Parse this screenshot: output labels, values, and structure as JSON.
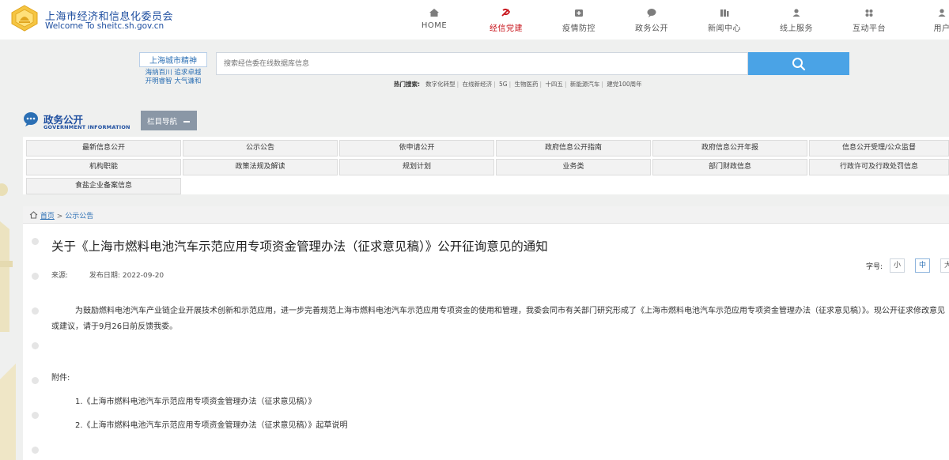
{
  "header": {
    "org_name": "上海市经济和信息化委员会",
    "welcome": "Welcome To sheitc.sh.gov.cn",
    "nav": [
      {
        "label": "HOME",
        "icon": "home-icon"
      },
      {
        "label": "经信党建",
        "icon": "party-emblem-icon",
        "active": true
      },
      {
        "label": "疫情防控",
        "icon": "medical-kit-icon"
      },
      {
        "label": "政务公开",
        "icon": "speech-bubble-icon"
      },
      {
        "label": "新闻中心",
        "icon": "news-icon"
      },
      {
        "label": "线上服务",
        "icon": "user-service-icon"
      },
      {
        "label": "互动平台",
        "icon": "interaction-icon"
      },
      {
        "label": "用户",
        "icon": "user-icon"
      }
    ]
  },
  "spirit": {
    "title": "上海城市精神",
    "line1": "海纳百川  追求卓越",
    "line2": "开明睿智  大气谦和"
  },
  "search": {
    "placeholder": "搜索经信委在线数据库信息",
    "button_icon": "search-icon"
  },
  "hot_search": {
    "label": "热门搜索:",
    "terms": [
      "数字化转型",
      "在线新经济",
      "5G",
      "生物医药",
      "十四五",
      "新能源汽车",
      "建党100周年"
    ]
  },
  "section": {
    "title": "政务公开",
    "subtitle": "GOVERNMENT INFORMATION",
    "column_nav_label": "栏目导航"
  },
  "menu": {
    "row1": [
      "最新信息公开",
      "公示公告",
      "依申请公开",
      "政府信息公开指南",
      "政府信息公开年报",
      "信息公开受理/公众监督"
    ],
    "row2": [
      "机构职能",
      "政策法规及解读",
      "规划计划",
      "业务类",
      "部门财政信息",
      "行政许可及行政处罚信息"
    ],
    "row3": [
      "食盐企业备案信息"
    ]
  },
  "breadcrumb": {
    "home": "首页",
    "sep": ">",
    "current": "公示公告"
  },
  "article": {
    "title": "关于《上海市燃料电池汽车示范应用专项资金管理办法（征求意见稿）》公开征询意见的通知",
    "source_label": "来源:",
    "date_label": "发布日期:",
    "date": "2022-09-20",
    "font_label": "字号:",
    "font_sizes": [
      "小",
      "中",
      "大"
    ],
    "font_active": "中",
    "body": "为鼓励燃料电池汽车产业链企业开展技术创新和示范应用，进一步完善规范上海市燃料电池汽车示范应用专项资金的使用和管理，我委会同市有关部门研究形成了《上海市燃料电池汽车示范应用专项资金管理办法（征求意见稿）》。现公开征求修改意见或建议，请于9月26日前反馈我委。",
    "attachments_label": "附件:",
    "attachments": [
      "1.《上海市燃料电池汽车示范应用专项资金管理办法（征求意见稿）》",
      "2.《上海市燃料电池汽车示范应用专项资金管理办法（征求意见稿）》起草说明"
    ]
  },
  "colors": {
    "brand_blue": "#1f4fa0",
    "accent_red": "#c8161d",
    "search_blue": "#4aa3e6",
    "link_blue": "#2b6fb4"
  }
}
